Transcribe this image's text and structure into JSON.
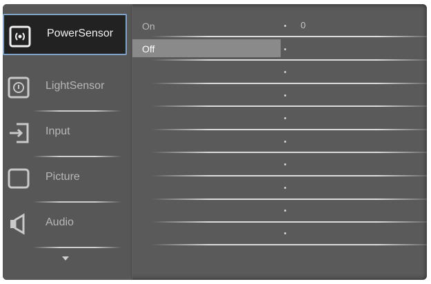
{
  "menu": {
    "items": [
      {
        "label": "PowerSensor",
        "icon": "power-sensor-icon",
        "active": true
      },
      {
        "label": "LightSensor",
        "icon": "light-sensor-icon",
        "active": false
      },
      {
        "label": "Input",
        "icon": "input-icon",
        "active": false
      },
      {
        "label": "Picture",
        "icon": "picture-icon",
        "active": false
      },
      {
        "label": "Audio",
        "icon": "audio-icon",
        "active": false
      }
    ],
    "more_icon": "chevron-down-icon"
  },
  "submenu": {
    "options": [
      {
        "label": "On",
        "selected": false
      },
      {
        "label": "Off",
        "selected": true
      }
    ],
    "value": "0"
  },
  "colors": {
    "panel": "#5a5a5a",
    "active_item_bg": "#222222",
    "active_border": "#7fa4c8",
    "selected_option_bg": "#8a8a8a"
  }
}
